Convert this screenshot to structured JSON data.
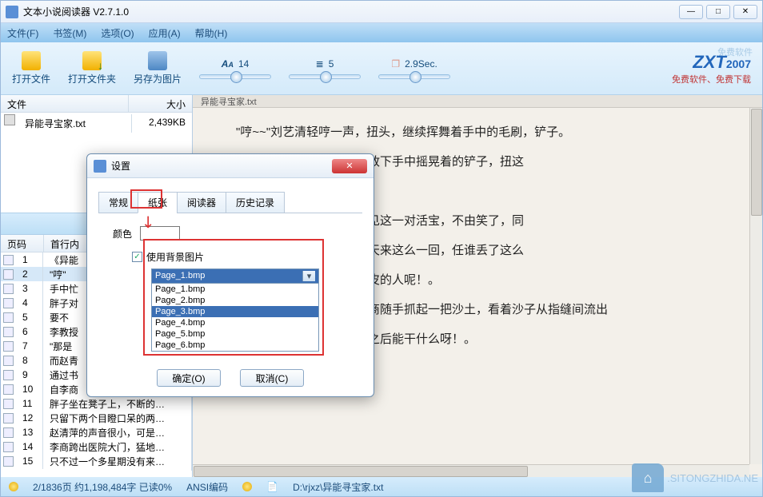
{
  "window": {
    "title": "文本小说阅读器 V2.7.1.0"
  },
  "menu": [
    "文件(F)",
    "书签(M)",
    "选项(O)",
    "应用(A)",
    "帮助(H)"
  ],
  "toolbar": {
    "open_file": "打开文件",
    "open_folder": "打开文件夹",
    "save_as_img": "另存为图片",
    "font_size": "14",
    "line_spacing": "5",
    "auto_scroll": "2.9Sec.",
    "free_sw": "免费软件",
    "logo": "ZXT",
    "logo_year": "2007",
    "logo_sub": "免费软件、免费下载"
  },
  "file_list": {
    "col_file": "文件",
    "col_size": "大小",
    "rows": [
      {
        "name": "异能寻宝家.txt",
        "size": "2,439KB"
      }
    ]
  },
  "page_table": {
    "col_page": "页码",
    "col_first": "首行内",
    "rows": [
      {
        "n": "1",
        "t": "《异能"
      },
      {
        "n": "2",
        "t": "\"哼\""
      },
      {
        "n": "3",
        "t": "手中忙"
      },
      {
        "n": "4",
        "t": "胖子对"
      },
      {
        "n": "5",
        "t": "要不"
      },
      {
        "n": "6",
        "t": "李教授"
      },
      {
        "n": "7",
        "t": "\"那是"
      },
      {
        "n": "8",
        "t": "而赵青"
      },
      {
        "n": "9",
        "t": "通过书"
      },
      {
        "n": "10",
        "t": "自李商"
      },
      {
        "n": "11",
        "t": "胖子坐在凳子上，不断的…"
      },
      {
        "n": "12",
        "t": "只留下两个目瞪口呆的两…"
      },
      {
        "n": "13",
        "t": "赵清萍的声音很小，可是…"
      },
      {
        "n": "14",
        "t": "李商跨出医院大门，猛地…"
      },
      {
        "n": "15",
        "t": "只不过一个多星期没有来…"
      }
    ],
    "selected": 1
  },
  "reader": {
    "file_header": "异能寻宝家.txt",
    "lines": [
      "\"哼~~\"刘艺清轻哼一声，扭头，继续挥舞着手中的毛刷，铲子。",
      "着不在理自己的刘艺清，放下手中摇晃着的铲子，扭这",
      "! \"",
      "外面请来考古发掘的人看见这一对活宝，不由笑了，同",
      "笑声，满不在乎，毕竟每天来这么一回，任谁丢了这么",
      "这个在考古系号称最厚脸皮的人呢！。",
      "看着这周围不见人烟，李商随手抓起一把沙土，看着沙子从指缝间流出",
      "这个偏门的考古系，毕业之后能干什么呀！。"
    ]
  },
  "dialog": {
    "title": "设置",
    "tabs": [
      "常规",
      "纸张",
      "阅读器",
      "历史记录"
    ],
    "active_tab": 1,
    "color_label": "颜色",
    "use_bg_label": "使用背景图片",
    "selected": "Page_1.bmp",
    "options": [
      "Page_1.bmp",
      "Page_2.bmp",
      "Page_3.bmp",
      "Page_4.bmp",
      "Page_5.bmp",
      "Page_6.bmp"
    ],
    "highlight": 2,
    "ok": "确定(O)",
    "cancel": "取消(C)"
  },
  "status": {
    "left": "2/1836页  约1,198,484字  已读0%",
    "encoding": "ANSI编码",
    "path": "D:\\rjxz\\异能寻宝家.txt"
  },
  "watermark": ".SITONGZHIDA.NE"
}
